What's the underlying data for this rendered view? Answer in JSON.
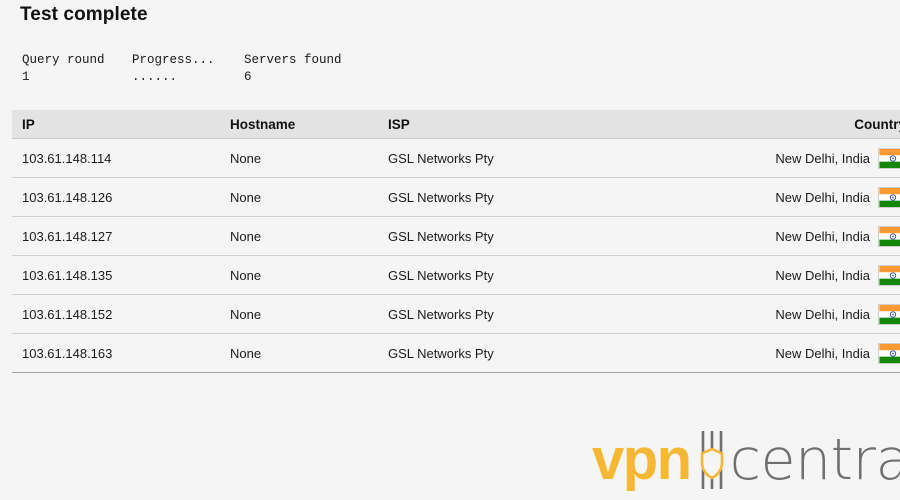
{
  "page": {
    "title": "Test complete",
    "background_color": "#f5f5f5"
  },
  "status": {
    "query_round": {
      "label": "Query round",
      "value": "1"
    },
    "progress": {
      "label": "Progress...",
      "value": "......"
    },
    "servers_found": {
      "label": "Servers found",
      "value": "6"
    }
  },
  "table": {
    "columns": [
      {
        "key": "ip",
        "label": "IP",
        "align": "left"
      },
      {
        "key": "hostname",
        "label": "Hostname",
        "align": "left"
      },
      {
        "key": "isp",
        "label": "ISP",
        "align": "left"
      },
      {
        "key": "country",
        "label": "Country",
        "align": "right"
      }
    ],
    "rows": [
      {
        "ip": "103.61.148.114",
        "hostname": "None",
        "isp": "GSL Networks Pty",
        "country": "New Delhi, India",
        "flag": "flag-india-icon"
      },
      {
        "ip": "103.61.148.126",
        "hostname": "None",
        "isp": "GSL Networks Pty",
        "country": "New Delhi, India",
        "flag": "flag-india-icon"
      },
      {
        "ip": "103.61.148.127",
        "hostname": "None",
        "isp": "GSL Networks Pty",
        "country": "New Delhi, India",
        "flag": "flag-india-icon"
      },
      {
        "ip": "103.61.148.135",
        "hostname": "None",
        "isp": "GSL Networks Pty",
        "country": "New Delhi, India",
        "flag": "flag-india-icon"
      },
      {
        "ip": "103.61.148.152",
        "hostname": "None",
        "isp": "GSL Networks Pty",
        "country": "New Delhi, India",
        "flag": "flag-india-icon"
      },
      {
        "ip": "103.61.148.163",
        "hostname": "None",
        "isp": "GSL Networks Pty",
        "country": "New Delhi, India",
        "flag": "flag-india-icon"
      }
    ]
  },
  "logo": {
    "primary_text": "vpn",
    "secondary_text": "central",
    "primary_color": "#f6b733",
    "secondary_color": "#6f6f72",
    "divider_icon": "shield-icon"
  },
  "colors": {
    "background": "#f5f5f5",
    "table_header": "#e3e3e3",
    "row_divider": "#d0d0d0",
    "table_bottom_border": "#9e9e9e",
    "flag_saffron": "#ff9933",
    "flag_white": "#ffffff",
    "flag_green": "#138808",
    "flag_chakra": "#2a4b9b"
  }
}
